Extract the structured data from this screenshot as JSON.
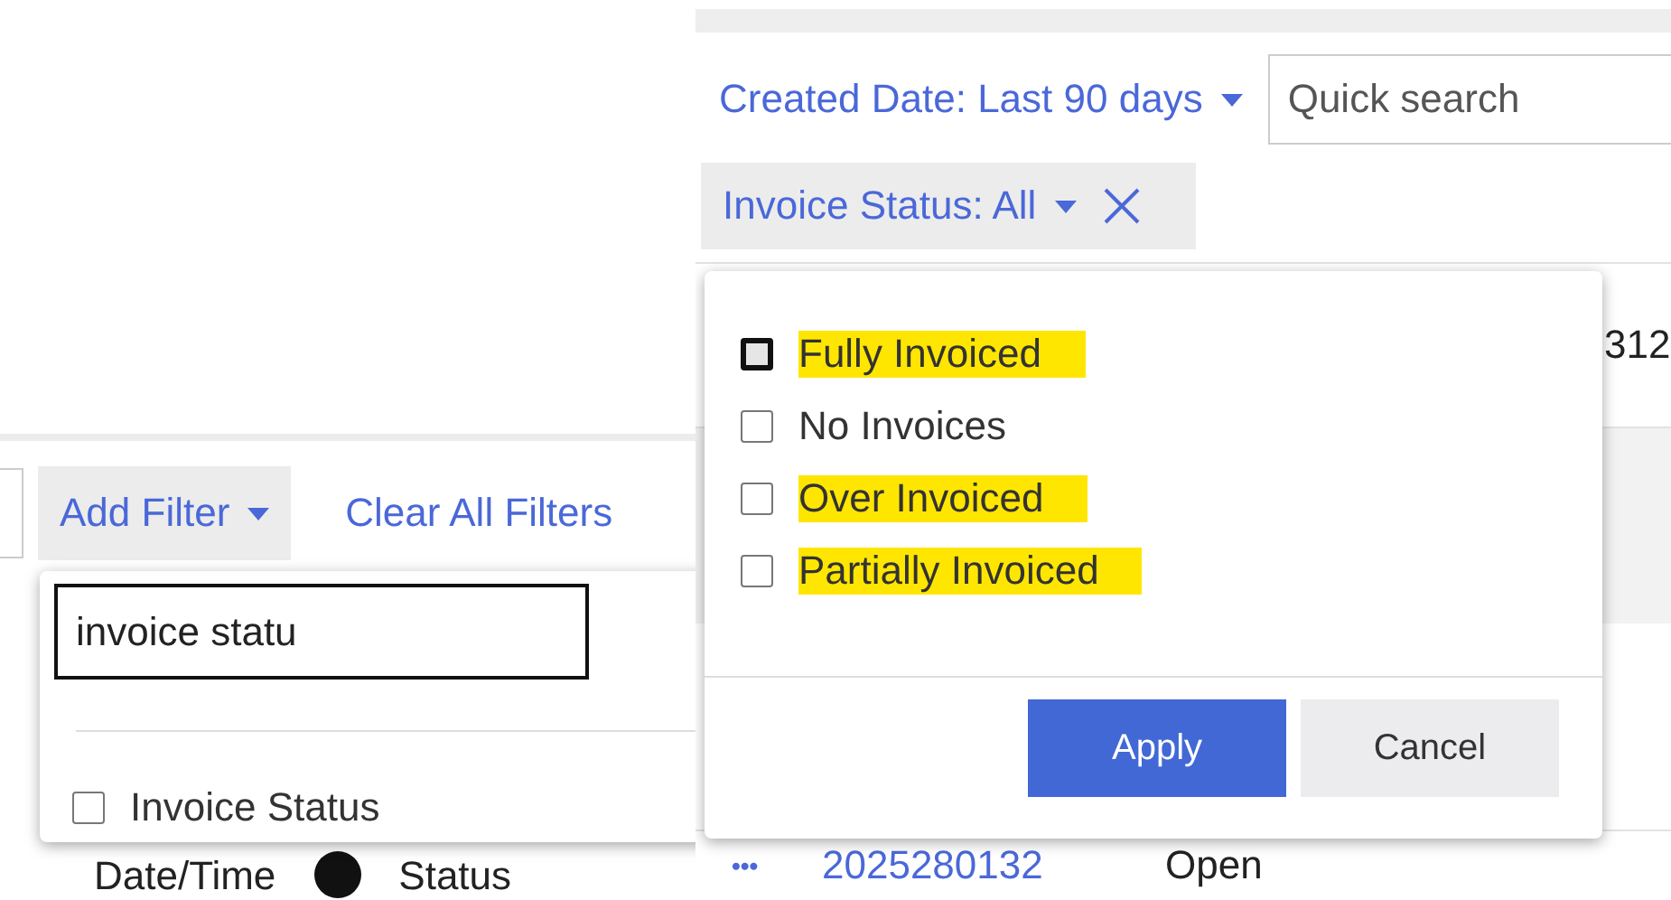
{
  "add_filter_panel": {
    "add_filter": "Add Filter",
    "clear_all": "Clear All Filters",
    "search": {
      "value": "invoice statu"
    },
    "options": [
      {
        "label": "Invoice Status",
        "checked": false
      }
    ],
    "table_headers": [
      "Date/Time",
      "Status"
    ]
  },
  "invoice_panel": {
    "created_date_filter": "Created Date: Last 90 days",
    "quick_search": {
      "placeholder": "Quick search"
    },
    "invoice_status_chip": "Invoice Status: All",
    "status_options": [
      {
        "label": "Fully Invoiced",
        "checked": false,
        "focused": true,
        "highlighted": true
      },
      {
        "label": "No Invoices",
        "checked": false,
        "focused": false,
        "highlighted": false
      },
      {
        "label": "Over Invoiced",
        "checked": false,
        "focused": false,
        "highlighted": true
      },
      {
        "label": "Partially Invoiced",
        "checked": false,
        "focused": false,
        "highlighted": true
      }
    ],
    "buttons": {
      "apply": "Apply",
      "cancel": "Cancel"
    },
    "table": {
      "cut_cell": "312",
      "rows": [
        {
          "actions": "•••",
          "order_number": "2025280132",
          "status": "Open"
        }
      ]
    }
  }
}
